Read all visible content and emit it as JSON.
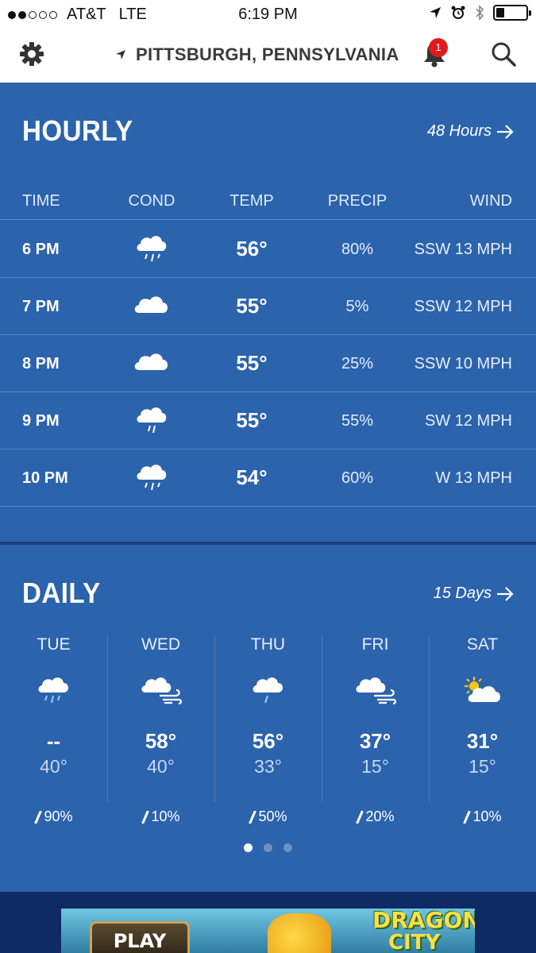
{
  "status_bar": {
    "carrier": "AT&T",
    "network": "LTE",
    "time": "6:19 PM",
    "signal_bars_filled": 2,
    "signal_bars_total": 5
  },
  "header": {
    "location": "PITTSBURGH, PENNSYLVANIA",
    "notification_count": "1",
    "icons": [
      "gear-icon",
      "location-arrow-icon",
      "bell-icon",
      "search-icon"
    ]
  },
  "hourly": {
    "title": "HOURLY",
    "link_label": "48 Hours",
    "columns": [
      "TIME",
      "COND",
      "TEMP",
      "PRECIP",
      "WIND"
    ],
    "rows": [
      {
        "time": "6 PM",
        "cond": "rain",
        "temp": "56°",
        "precip": "80%",
        "wind": "SSW 13 MPH"
      },
      {
        "time": "7 PM",
        "cond": "cloudy",
        "temp": "55°",
        "precip": "5%",
        "wind": "SSW 12 MPH"
      },
      {
        "time": "8 PM",
        "cond": "cloudy",
        "temp": "55°",
        "precip": "25%",
        "wind": "SSW 10 MPH"
      },
      {
        "time": "9 PM",
        "cond": "rain",
        "temp": "55°",
        "precip": "55%",
        "wind": "SW 12 MPH"
      },
      {
        "time": "10 PM",
        "cond": "rain",
        "temp": "54°",
        "precip": "60%",
        "wind": "W 13 MPH"
      }
    ]
  },
  "daily": {
    "title": "DAILY",
    "link_label": "15 Days",
    "days": [
      {
        "name": "TUE",
        "cond": "rain",
        "hi": "--",
        "lo": "40°",
        "precip": "90%"
      },
      {
        "name": "WED",
        "cond": "wind-cloud",
        "hi": "58°",
        "lo": "40°",
        "precip": "10%"
      },
      {
        "name": "THU",
        "cond": "light-rain",
        "hi": "56°",
        "lo": "33°",
        "precip": "50%"
      },
      {
        "name": "FRI",
        "cond": "wind-cloud",
        "hi": "37°",
        "lo": "15°",
        "precip": "20%"
      },
      {
        "name": "SAT",
        "cond": "partly-sunny",
        "hi": "31°",
        "lo": "15°",
        "precip": "10%"
      }
    ],
    "pager": {
      "pages": 3,
      "active": 1
    }
  },
  "ad": {
    "button": "PLAY NOW",
    "logo_line1": "DRAGON",
    "logo_line2": "CITY"
  },
  "colors": {
    "panel": "#2b63ad",
    "divider": "#1c3f7a",
    "badge": "#e01b1b",
    "ad_bar": "#0f2b63"
  }
}
